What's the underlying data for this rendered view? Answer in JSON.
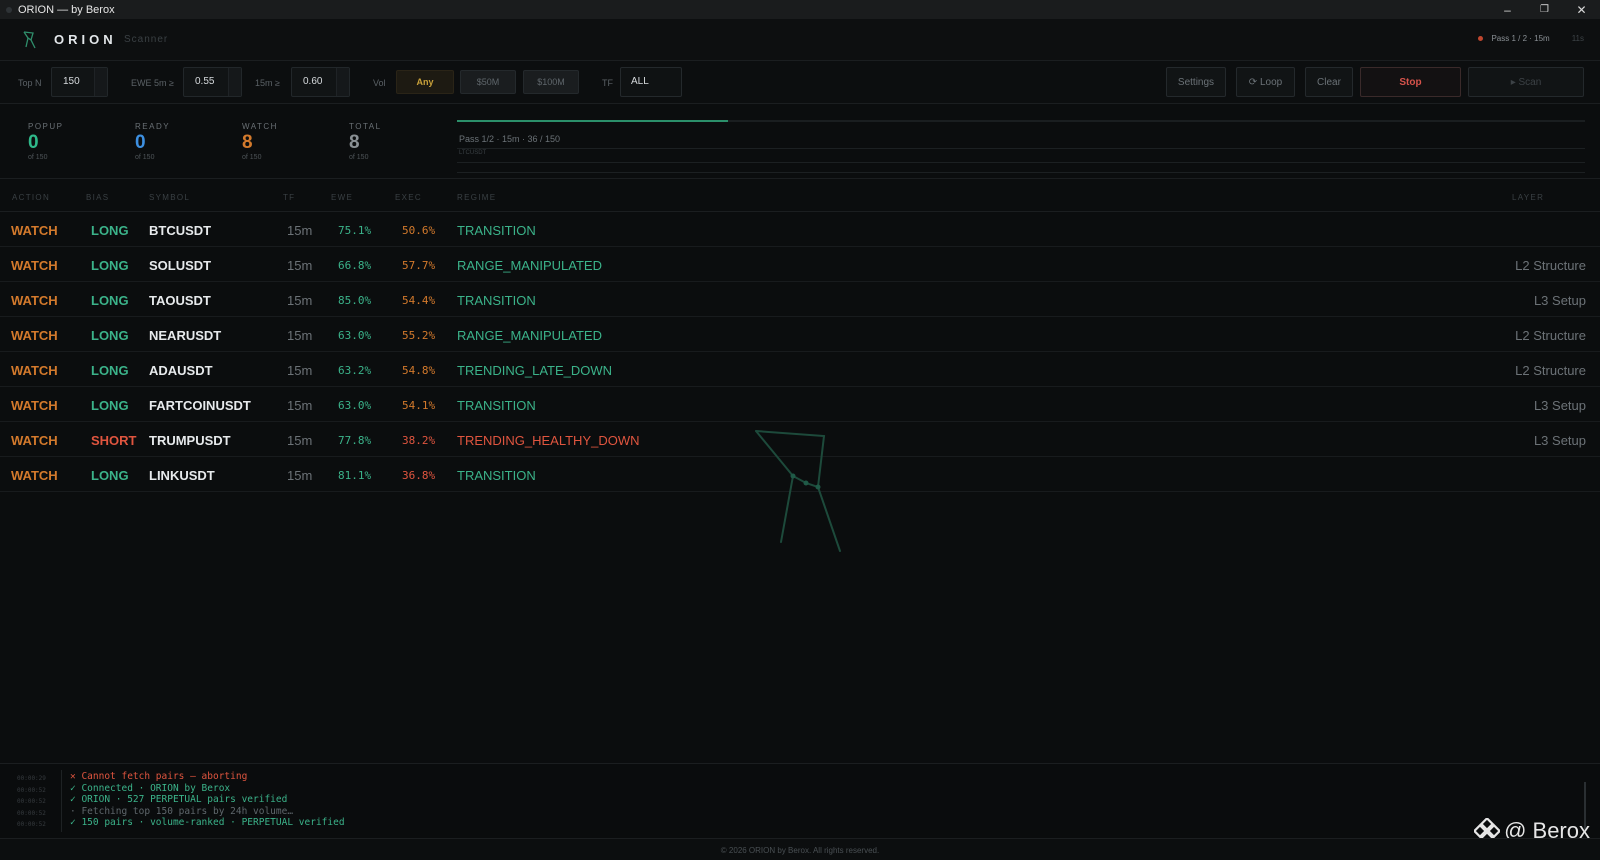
{
  "window": {
    "title": "ORION  —  by Berox",
    "min": "–",
    "max": "❐",
    "close": "✕"
  },
  "header": {
    "brand": "ORION",
    "subtitle": "Scanner",
    "status": "Pass 1 / 2  ·  15m",
    "status_time": "11s"
  },
  "controls": {
    "topn_label": "Top N",
    "topn_value": "150",
    "ewe5_label": "EWE 5m ≥",
    "ewe5_value": "0.55",
    "ewe15_label": "15m ≥",
    "ewe15_value": "0.60",
    "vol_label": "Vol",
    "vol_options": [
      "Any",
      "$50M",
      "$100M"
    ],
    "vol_selected": "Any",
    "tf_label": "TF",
    "tf_value": "ALL",
    "settings": "Settings",
    "loop": "⟳ Loop",
    "clear": "Clear",
    "stop": "Stop",
    "scan": "▸ Scan"
  },
  "stats": {
    "popup": {
      "label": "POPUP",
      "value": "0",
      "sub": "of 150",
      "color": "#2fb98a"
    },
    "ready": {
      "label": "READY",
      "value": "0",
      "sub": "of 150",
      "color": "#3d8fe0"
    },
    "watch": {
      "label": "WATCH",
      "value": "8",
      "sub": "of 150",
      "color": "#d47a2c"
    },
    "total": {
      "label": "TOTAL",
      "value": "8",
      "sub": "of 150",
      "color": "#8a9094"
    }
  },
  "progress": {
    "text": "Pass 1/2  ·  15m  ·  36 / 150",
    "current": "LTCUSDT",
    "fraction": 0.24
  },
  "table": {
    "headers": {
      "action": "ACTION",
      "bias": "BIAS",
      "symbol": "SYMBOL",
      "tf": "TF",
      "ewe": "EWE",
      "exec": "EXEC",
      "regime": "REGIME",
      "layer": "LAYER"
    },
    "rows": [
      {
        "action": "WATCH",
        "bias": "LONG",
        "symbol": "BTCUSDT",
        "tf": "15m",
        "ewe": "75.1%",
        "exec": "50.6%",
        "regime": "TRANSITION",
        "layer": ""
      },
      {
        "action": "WATCH",
        "bias": "LONG",
        "symbol": "SOLUSDT",
        "tf": "15m",
        "ewe": "66.8%",
        "exec": "57.7%",
        "regime": "RANGE_MANIPULATED",
        "layer": "L2  Structure"
      },
      {
        "action": "WATCH",
        "bias": "LONG",
        "symbol": "TAOUSDT",
        "tf": "15m",
        "ewe": "85.0%",
        "exec": "54.4%",
        "regime": "TRANSITION",
        "layer": "L3  Setup"
      },
      {
        "action": "WATCH",
        "bias": "LONG",
        "symbol": "NEARUSDT",
        "tf": "15m",
        "ewe": "63.0%",
        "exec": "55.2%",
        "regime": "RANGE_MANIPULATED",
        "layer": "L2  Structure"
      },
      {
        "action": "WATCH",
        "bias": "LONG",
        "symbol": "ADAUSDT",
        "tf": "15m",
        "ewe": "63.2%",
        "exec": "54.8%",
        "regime": "TRENDING_LATE_DOWN",
        "layer": "L2  Structure"
      },
      {
        "action": "WATCH",
        "bias": "LONG",
        "symbol": "FARTCOINUSDT",
        "tf": "15m",
        "ewe": "63.0%",
        "exec": "54.1%",
        "regime": "TRANSITION",
        "layer": "L3  Setup"
      },
      {
        "action": "WATCH",
        "bias": "SHORT",
        "symbol": "TRUMPUSDT",
        "tf": "15m",
        "ewe": "77.8%",
        "exec": "38.2%",
        "regime": "TRENDING_HEALTHY_DOWN",
        "layer": "L3  Setup"
      },
      {
        "action": "WATCH",
        "bias": "LONG",
        "symbol": "LINKUSDT",
        "tf": "15m",
        "ewe": "81.1%",
        "exec": "36.8%",
        "regime": "TRANSITION",
        "layer": ""
      }
    ]
  },
  "colors": {
    "long": "#3bb38a",
    "short": "#e0553f",
    "ewe": "#3bb38a",
    "exec_ok": "#d47a2c",
    "exec_low": "#e0553f",
    "regime_ok": "#3bb38a",
    "regime_short": "#e0553f",
    "success": "#3bb38a",
    "error": "#e0553f",
    "muted": "#5f676c"
  },
  "log": {
    "times": [
      "00:00:29",
      "00:00:52",
      "00:00:52",
      "00:00:52",
      "00:00:52"
    ],
    "lines": [
      {
        "text": "✕ Cannot fetch pairs — aborting",
        "level": "error"
      },
      {
        "text": "✓ Connected · ORION by Berox",
        "level": "success"
      },
      {
        "text": "✓ ORION · 527 PERPETUAL pairs verified",
        "level": "success"
      },
      {
        "text": "· Fetching top 150 pairs by 24h volume…",
        "level": "muted"
      },
      {
        "text": "✓ 150 pairs · volume-ranked · PERPETUAL verified",
        "level": "success"
      }
    ]
  },
  "footer": {
    "copyright": "© 2026 ORION by Berox. All rights reserved.",
    "watermark": "@ Berox"
  },
  "icons": {
    "logo": "orion-constellation-icon",
    "berox": "berox-diamond-icon"
  }
}
